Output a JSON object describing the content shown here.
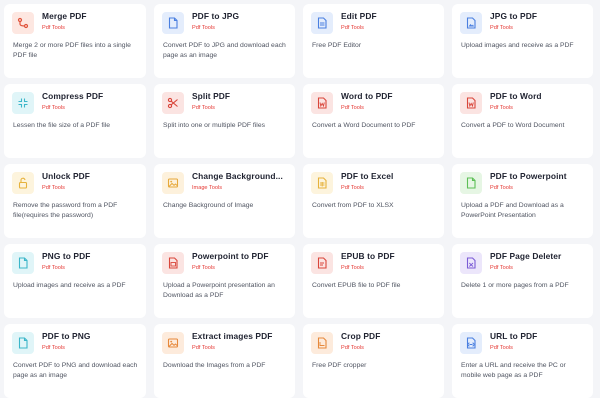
{
  "colors": {
    "background": "#f4f5f8",
    "card": "#ffffff",
    "pdf_tools_tag": "#e53935",
    "image_tools_tag": "#e53935"
  },
  "tools": [
    {
      "title": "Merge PDF",
      "category": "Pdf Tools",
      "description": "Merge 2 or more PDF files into a single PDF file",
      "icon": "merge-icon",
      "icon_color": "#e0533b",
      "icon_bg": "#fde7e1"
    },
    {
      "title": "PDF to JPG",
      "category": "Pdf Tools",
      "description": "Convert PDF to JPG and download each page as an image",
      "icon": "document-icon",
      "icon_color": "#4a7fe0",
      "icon_bg": "#e4edfc"
    },
    {
      "title": "Edit PDF",
      "category": "Pdf Tools",
      "description": "Free PDF Editor",
      "icon": "edit-document-icon",
      "icon_color": "#4a7fe0",
      "icon_bg": "#e4edfc"
    },
    {
      "title": "JPG to PDF",
      "category": "Pdf Tools",
      "description": "Upload images and receive as a PDF",
      "icon": "image-document-icon",
      "icon_color": "#4a7fe0",
      "icon_bg": "#e4edfc"
    },
    {
      "title": "Compress PDF",
      "category": "Pdf Tools",
      "description": "Lessen the file size of a PDF file",
      "icon": "compress-icon",
      "icon_color": "#3bb6c9",
      "icon_bg": "#e0f5f8"
    },
    {
      "title": "Split PDF",
      "category": "Pdf Tools",
      "description": "Split into one or multiple PDF files",
      "icon": "scissors-icon",
      "icon_color": "#d9463b",
      "icon_bg": "#fbe4e2"
    },
    {
      "title": "Word to PDF",
      "category": "Pdf Tools",
      "description": "Convert a Word Document to PDF",
      "icon": "word-document-icon",
      "icon_color": "#d9463b",
      "icon_bg": "#fbe4e2"
    },
    {
      "title": "PDF to Word",
      "category": "Pdf Tools",
      "description": "Convert a PDF to Word Document",
      "icon": "word-document-icon",
      "icon_color": "#d9463b",
      "icon_bg": "#fbe4e2"
    },
    {
      "title": "Unlock PDF",
      "category": "Pdf Tools",
      "description": "Remove the password from a PDF file(requires the password)",
      "icon": "unlock-icon",
      "icon_color": "#e6b23c",
      "icon_bg": "#fdf4dd"
    },
    {
      "title": "Change Background...",
      "category": "Image Tools",
      "description": "Change Background of Image",
      "icon": "image-icon",
      "icon_color": "#e6a93c",
      "icon_bg": "#fdf1dc"
    },
    {
      "title": "PDF to Excel",
      "category": "Pdf Tools",
      "description": "Convert from PDF to XLSX",
      "icon": "spreadsheet-document-icon",
      "icon_color": "#e6b23c",
      "icon_bg": "#fdf4dd"
    },
    {
      "title": "PDF to Powerpoint",
      "category": "Pdf Tools",
      "description": "Upload a PDF and Download as a PowerPoint Presentation",
      "icon": "document-icon",
      "icon_color": "#5cbf55",
      "icon_bg": "#e6f6e4"
    },
    {
      "title": "PNG to PDF",
      "category": "Pdf Tools",
      "description": "Upload images and receive as a PDF",
      "icon": "document-icon",
      "icon_color": "#3bb6c9",
      "icon_bg": "#e0f5f8"
    },
    {
      "title": "Powerpoint to PDF",
      "category": "Pdf Tools",
      "description": "Upload a Powerpoint presentation an Download as a PDF",
      "icon": "slides-document-icon",
      "icon_color": "#d9463b",
      "icon_bg": "#fbe4e2"
    },
    {
      "title": "EPUB to PDF",
      "category": "Pdf Tools",
      "description": "Convert EPUB file to PDF file",
      "icon": "book-document-icon",
      "icon_color": "#d9463b",
      "icon_bg": "#fbe4e2"
    },
    {
      "title": "PDF Page Deleter",
      "category": "Pdf Tools",
      "description": "Delete 1 or more pages from a PDF",
      "icon": "delete-document-icon",
      "icon_color": "#7b5bd6",
      "icon_bg": "#ece6fb"
    },
    {
      "title": "PDF to PNG",
      "category": "Pdf Tools",
      "description": "Convert PDF to PNG and download each page as an image",
      "icon": "document-icon",
      "icon_color": "#3bb6c9",
      "icon_bg": "#e0f5f8"
    },
    {
      "title": "Extract images PDF",
      "category": "Pdf Tools",
      "description": "Download the Images from a PDF",
      "icon": "image-icon",
      "icon_color": "#e6893c",
      "icon_bg": "#fdebdc"
    },
    {
      "title": "Crop PDF",
      "category": "Pdf Tools",
      "description": "Free PDF cropper",
      "icon": "crop-document-icon",
      "icon_color": "#e6893c",
      "icon_bg": "#fdebdc"
    },
    {
      "title": "URL to PDF",
      "category": "Pdf Tools",
      "description": "Enter a URL and receive the PC or mobile web page as a PDF",
      "icon": "link-document-icon",
      "icon_color": "#4a7fe0",
      "icon_bg": "#e4edfc"
    }
  ]
}
